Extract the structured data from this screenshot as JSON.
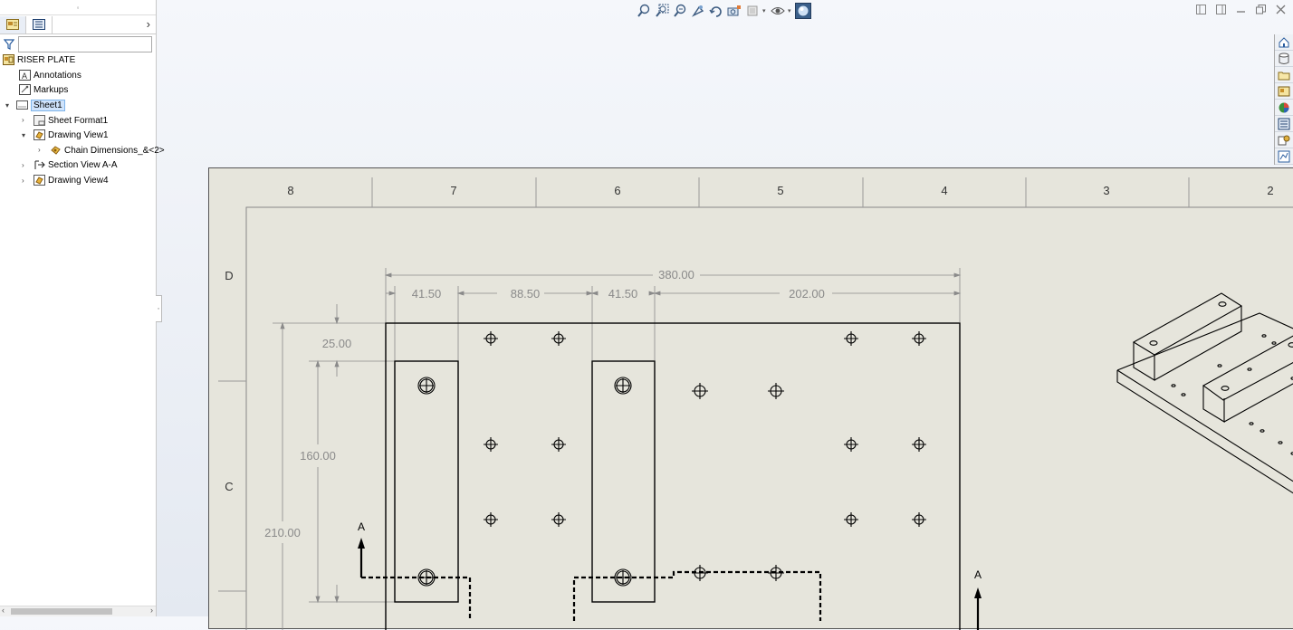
{
  "feature_tree": {
    "root": "RISER PLATE",
    "items": [
      {
        "label": "Annotations",
        "icon": "annotations-icon"
      },
      {
        "label": "Markups",
        "icon": "markups-icon"
      },
      {
        "label": "Sheet1",
        "icon": "sheet-icon"
      },
      {
        "label": "Sheet Format1",
        "icon": "sheet-format-icon"
      },
      {
        "label": "Drawing View1",
        "icon": "drawing-view-icon"
      },
      {
        "label": "Chain Dimensions_&<2>",
        "icon": "chain-dimension-icon"
      },
      {
        "label": "Section View A-A",
        "icon": "section-view-icon"
      },
      {
        "label": "Drawing View4",
        "icon": "drawing-view-icon"
      }
    ]
  },
  "sheet": {
    "zone_columns": [
      "8",
      "7",
      "6",
      "5",
      "4",
      "3",
      "2"
    ],
    "zone_rows": [
      "D",
      "C"
    ]
  },
  "dimensions": {
    "overall_width": "380.00",
    "d1": "41.50",
    "d2": "88.50",
    "d3": "41.50",
    "d4": "202.00",
    "top_offset": "25.00",
    "slot_length": "160.00",
    "overall_height": "210.00"
  },
  "section_labels": {
    "left": "A",
    "right": "A"
  },
  "colors": {
    "sheet_bg": "#e6e5dc",
    "dimension": "#7a7a7a",
    "geometry": "#000000",
    "selection": "#cfe3fb"
  }
}
